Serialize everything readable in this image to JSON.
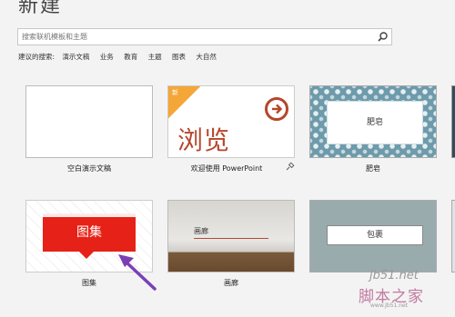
{
  "page": {
    "title": "新建"
  },
  "search": {
    "placeholder": "搜索联机模板和主题"
  },
  "suggestions": {
    "label": "建议的搜索:",
    "items": [
      "演示文稿",
      "业务",
      "教育",
      "主题",
      "图表",
      "大自然"
    ]
  },
  "templates": [
    {
      "label": "空白演示文稿"
    },
    {
      "label": "欢迎使用 PowerPoint",
      "thumb_text": "浏览",
      "corner_text": "新",
      "pinned": true
    },
    {
      "label": "肥皂",
      "thumb_text": "肥皂"
    },
    {
      "label": "图集",
      "thumb_text": "图集"
    },
    {
      "label": "画廊",
      "thumb_text": "画廊"
    },
    {
      "label": "",
      "thumb_text": "包裹"
    }
  ],
  "colors": {
    "accent_orange": "#f4a637",
    "brand_red": "#b5462b",
    "tuji_red": "#e62117",
    "annotation_arrow": "#7b3fb5"
  },
  "watermark": {
    "site": "jb51.net",
    "text": "脚本之家",
    "sub": "www.Jb51.net"
  }
}
